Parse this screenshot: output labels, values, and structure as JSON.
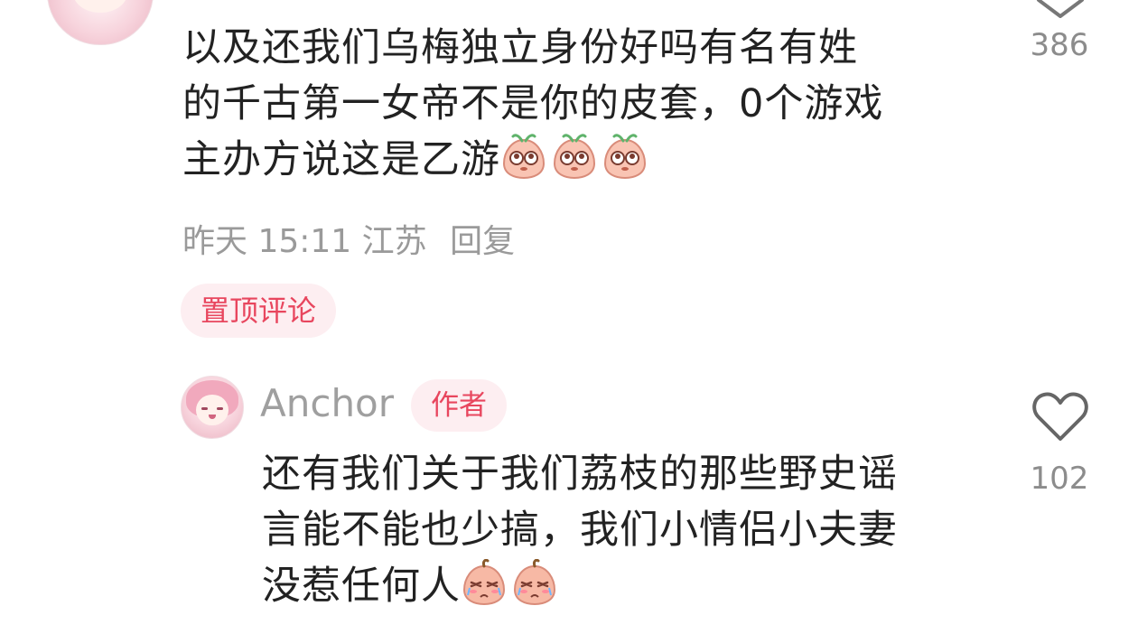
{
  "comment1": {
    "lines": [
      "以及还我们乌梅独立身份好吗有名有姓",
      "的千古第一女帝不是你的皮套，0个游戏",
      "主办方说这是乙游"
    ],
    "emoji": [
      "peach-eyes-emoji",
      "peach-eyes-emoji",
      "peach-eyes-emoji"
    ],
    "time": "昨天 15:11",
    "location": "江苏",
    "reply_label": "回复",
    "pin_label": "置顶评论",
    "like_count": "386"
  },
  "comment2": {
    "author": "Anchor",
    "author_badge": "作者",
    "lines": [
      "还有我们关于我们荔枝的那些野史谣",
      "言能不能也少搞，我们小情侣小夫妻",
      "没惹任何人"
    ],
    "emoji": [
      "peach-crying-emoji",
      "peach-crying-emoji"
    ],
    "like_count": "102"
  },
  "colors": {
    "accent": "#e8465e",
    "badge_bg": "#fdeef1",
    "meta_text": "#9a9a9a"
  }
}
